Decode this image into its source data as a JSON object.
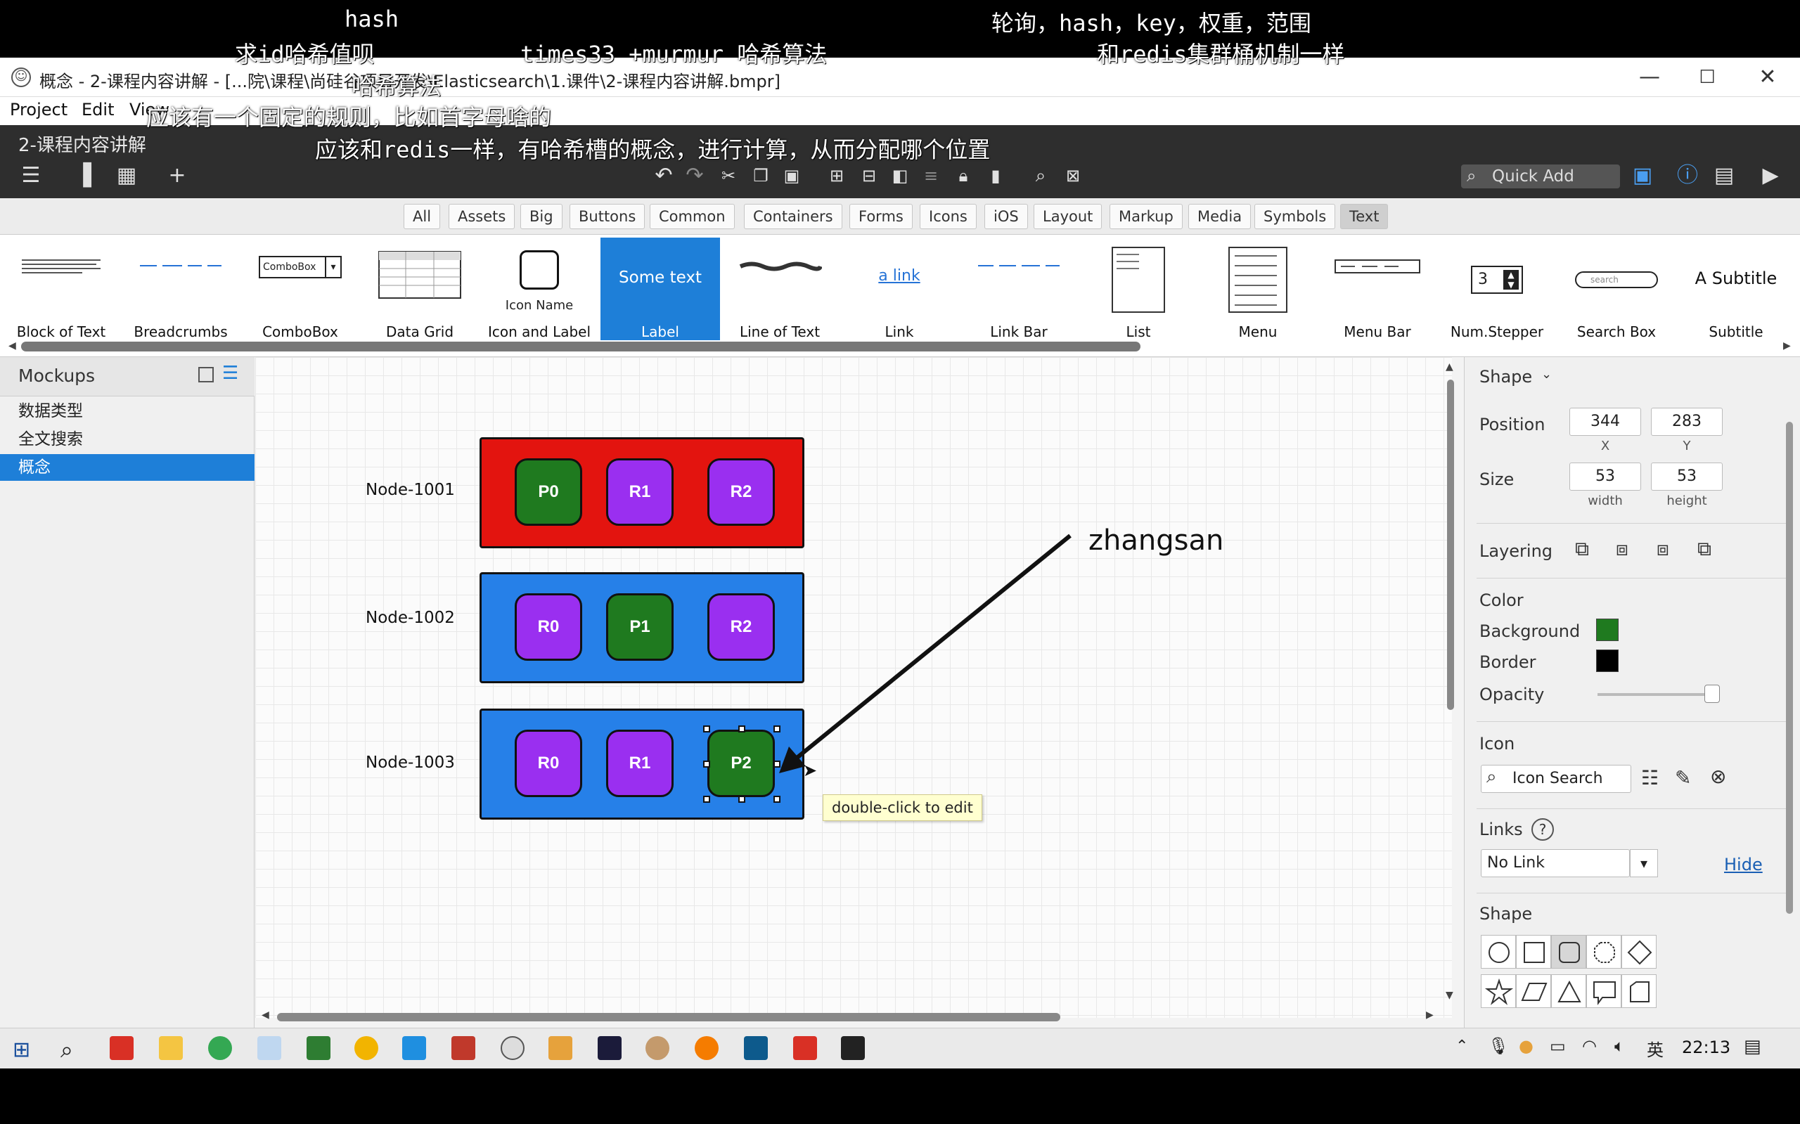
{
  "annotations": {
    "line1_left": "hash",
    "line1_right": "轮询，hash，key，权重，范围",
    "line2_left": "求id哈希值呗",
    "line2_mid": "times33 +murmur 哈希算法",
    "line2_right": "和redis集群桶机制一样",
    "line3": "哈希算法",
    "line4": "应该有一个固定的规则，比如首字母啥的",
    "line5": "应该和redis一样，有哈希槽的概念，进行计算，从而分配哪个位置"
  },
  "window": {
    "title": "概念 - 2-课程内容讲解 - [...院\\课程\\尚硅谷项目开发\\Elasticsearch\\1.课件\\2-课程内容讲解.bmpr]",
    "minimize": "—",
    "maximize": "☐",
    "close": "✕"
  },
  "menu": [
    "Project",
    "Edit",
    "View"
  ],
  "toolbar": {
    "document_title": "2-课程内容讲解",
    "quick_add_placeholder": "Quick Add"
  },
  "library_tabs": [
    "All",
    "Assets",
    "Big",
    "Buttons",
    "Common",
    "Containers",
    "Forms",
    "Icons",
    "iOS",
    "Layout",
    "Markup",
    "Media",
    "Symbols",
    "Text"
  ],
  "library_active_tab": "Text",
  "library_items": [
    {
      "label": "Block of Text"
    },
    {
      "label": "Breadcrumbs"
    },
    {
      "label": "ComboBox",
      "thumb_text": "ComboBox"
    },
    {
      "label": "Data Grid"
    },
    {
      "label": "Icon and Label",
      "thumb_text": "Icon Name"
    },
    {
      "label": "Label",
      "thumb_text": "Some text"
    },
    {
      "label": "Line of Text"
    },
    {
      "label": "Link",
      "thumb_text": "a link"
    },
    {
      "label": "Link Bar"
    },
    {
      "label": "List"
    },
    {
      "label": "Menu"
    },
    {
      "label": "Menu Bar"
    },
    {
      "label": "Num.Stepper",
      "thumb_text": "3"
    },
    {
      "label": "Search Box",
      "thumb_text": "search"
    },
    {
      "label": "Subtitle",
      "thumb_text": "A Subtitle"
    }
  ],
  "mockups_panel": {
    "title": "Mockups",
    "items": [
      "数据类型",
      "全文搜索",
      "概念"
    ],
    "selected": "概念"
  },
  "canvas": {
    "nodes": [
      {
        "name": "Node-1001",
        "color": "#e3140f",
        "shards": [
          {
            "label": "P0",
            "kind": "primary"
          },
          {
            "label": "R1",
            "kind": "replica"
          },
          {
            "label": "R2",
            "kind": "replica"
          }
        ]
      },
      {
        "name": "Node-1002",
        "color": "#2680e8",
        "shards": [
          {
            "label": "R0",
            "kind": "replica"
          },
          {
            "label": "P1",
            "kind": "primary"
          },
          {
            "label": "R2",
            "kind": "replica"
          }
        ]
      },
      {
        "name": "Node-1003",
        "color": "#2680e8",
        "shards": [
          {
            "label": "R0",
            "kind": "replica"
          },
          {
            "label": "R1",
            "kind": "replica"
          },
          {
            "label": "P2",
            "kind": "primary"
          }
        ]
      }
    ],
    "arrow_label": "zhangsan",
    "tooltip": "double-click to edit"
  },
  "properties": {
    "header": "Shape",
    "position_label": "Position",
    "x": "344",
    "y": "283",
    "x_caption": "X",
    "y_caption": "Y",
    "size_label": "Size",
    "width": "53",
    "height": "53",
    "width_caption": "width",
    "height_caption": "height",
    "layering_label": "Layering",
    "color_label": "Color",
    "background_label": "Background",
    "background_color": "#1f7a1f",
    "border_label": "Border",
    "border_color": "#000000",
    "opacity_label": "Opacity",
    "opacity": 1.0,
    "icon_label": "Icon",
    "icon_search_placeholder": "Icon Search",
    "links_label": "Links",
    "links_help": "?",
    "link_value": "No Link",
    "hide_label": "Hide",
    "shape_label": "Shape"
  },
  "taskbar": {
    "ime": "英",
    "time": "22:13"
  }
}
